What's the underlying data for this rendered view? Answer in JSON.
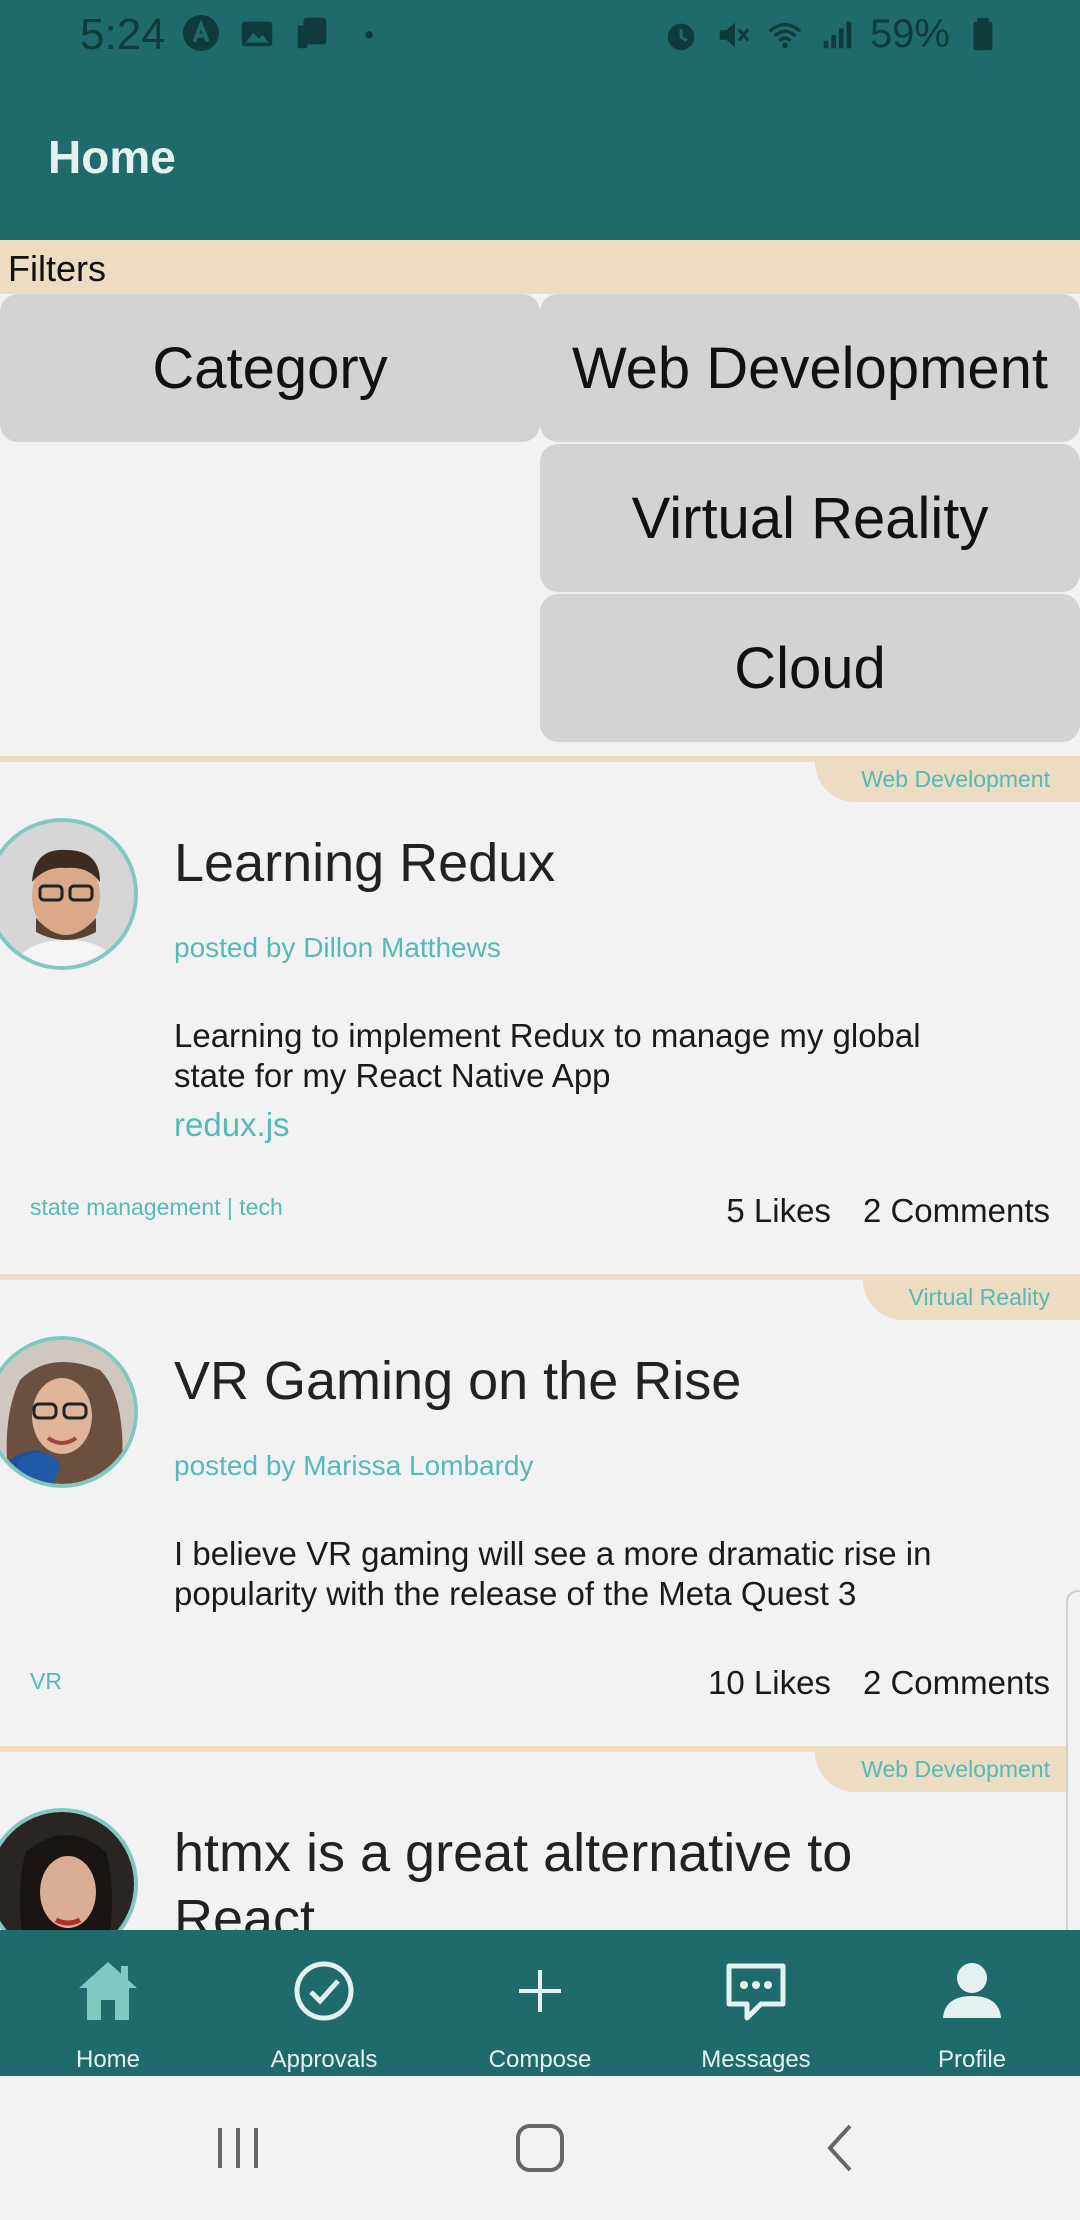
{
  "status_bar": {
    "time": "5:24",
    "battery_percent": "59%",
    "left_icons": [
      "a-circle-icon",
      "photo-icon",
      "cast-icon",
      "dot-icon"
    ],
    "right_icons": [
      "alarm-icon",
      "mute-icon",
      "wifi-icon",
      "signal-icon",
      "battery-icon"
    ]
  },
  "header": {
    "title": "Home"
  },
  "filters": {
    "label": "Filters",
    "category_label": "Category",
    "options": [
      "Web Development",
      "Virtual Reality",
      "Cloud"
    ]
  },
  "posts": [
    {
      "category": "Web Development",
      "title": "Learning Redux",
      "author": "posted by Dillon Matthews",
      "body": "Learning to implement Redux to manage my global state for my React Native App",
      "link": "redux.js",
      "tags": "state management | tech",
      "likes": "5 Likes",
      "comments": "2 Comments"
    },
    {
      "category": "Virtual Reality",
      "title": "VR Gaming on the Rise",
      "author": "posted by Marissa Lombardy",
      "body": "I believe VR gaming will see a more dramatic rise in popularity with the release of the Meta Quest 3",
      "link": "",
      "tags": "VR",
      "likes": "10 Likes",
      "comments": "2 Comments"
    },
    {
      "category": "Web Development",
      "title": "htmx is a great alternative to React",
      "author": "",
      "body": "",
      "link": "",
      "tags": "",
      "likes": "",
      "comments": ""
    }
  ],
  "bottom_nav": {
    "items": [
      {
        "label": "Home",
        "icon": "home-icon",
        "active": true
      },
      {
        "label": "Approvals",
        "icon": "check-circle-icon",
        "active": false
      },
      {
        "label": "Compose",
        "icon": "plus-icon",
        "active": false
      },
      {
        "label": "Messages",
        "icon": "chat-bubble-icon",
        "active": false
      },
      {
        "label": "Profile",
        "icon": "person-icon",
        "active": false
      }
    ]
  },
  "colors": {
    "primary": "#1f6b6b",
    "accent": "#56b9b9",
    "filter_bar": "#ecdcc2",
    "filter_button": "#d3d3d3",
    "background": "#f2f2f2",
    "active_nav_icon": "#7fc9c2"
  }
}
